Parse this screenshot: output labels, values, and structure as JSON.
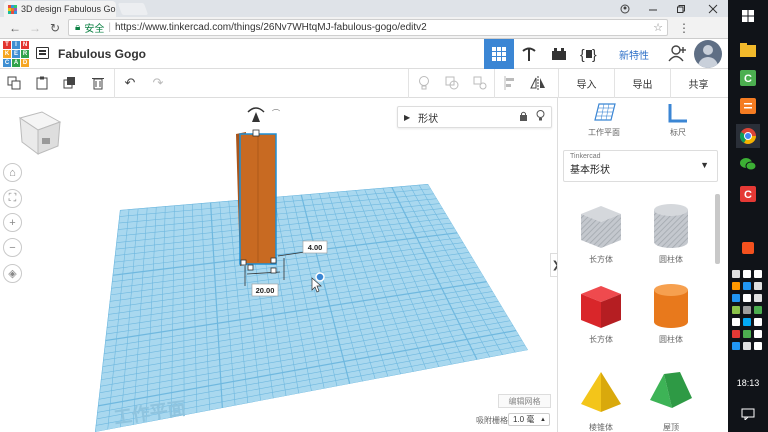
{
  "browser": {
    "tab_title": "3D design Fabulous Go",
    "tab_close": "×",
    "address_secure": "安全",
    "url": "https://www.tinkercad.com/things/26Nv7WHtqMJ-fabulous-gogo/editv2",
    "back_icon": "back-arrow-icon",
    "forward_icon": "forward-arrow-icon",
    "reload_icon": "reload-icon"
  },
  "header": {
    "logo_letters": [
      "TIN",
      "KER",
      "CAD"
    ],
    "project_title": "Fabulous Gogo",
    "new_features": "新特性",
    "colors": {
      "grid_view_active": "#3b86d4",
      "accent_blue": "#2c6fc7"
    }
  },
  "toolbar": {
    "import": "导入",
    "export": "导出",
    "share": "共享"
  },
  "workspace": {
    "shape_panel_label": "形状",
    "workplane_label": "工作平面",
    "dimension_width": "20.00",
    "dimension_depth": "4.00",
    "edit_grid": "编辑网格",
    "snap_grid_label": "吸附栅格",
    "snap_grid_value": "1.0 毫",
    "colors": {
      "grid": "#a9d8ef",
      "grid_lines": "#6fb8df",
      "box": "#c86a22",
      "box_outline": "#1d8fd6"
    }
  },
  "right_panel": {
    "workplane_tool": "工作平面",
    "ruler_tool": "标尺",
    "library_source": "Tinkercad",
    "library_name": "基本形状",
    "shapes": [
      {
        "label": "长方体",
        "color": "#b8bcc2",
        "kind": "box-hole"
      },
      {
        "label": "圆柱体",
        "color": "#b8bcc2",
        "kind": "cyl-hole"
      },
      {
        "label": "长方体",
        "color": "#d9262a",
        "kind": "box"
      },
      {
        "label": "圆柱体",
        "color": "#e8791c",
        "kind": "cyl"
      },
      {
        "label": "棱锥体",
        "color": "#f3c51a",
        "kind": "pyramid"
      },
      {
        "label": "屋顶",
        "color": "#2e9a45",
        "kind": "roof"
      }
    ]
  },
  "taskbar": {
    "time": "18:13"
  }
}
